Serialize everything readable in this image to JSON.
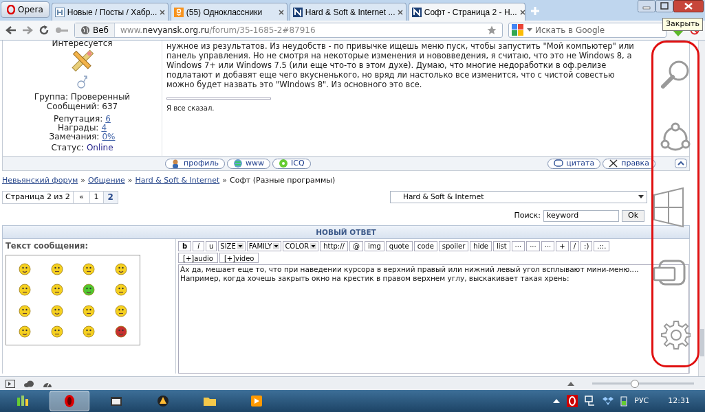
{
  "browser": {
    "menu_label": "Opera",
    "tabs": [
      {
        "title": "Новые / Посты / Хабр...",
        "kind": "habr",
        "selected": false
      },
      {
        "title": "(55) Одноклассники",
        "kind": "ok",
        "selected": false
      },
      {
        "title": "Hard & Soft & Internet ...",
        "kind": "n",
        "selected": false
      },
      {
        "title": "Софт - Страница 2 - Н...",
        "kind": "n",
        "selected": true
      }
    ],
    "badge": "Веб",
    "url_prefix": "www.",
    "url_host": "nevyansk.org.ru",
    "url_path": "/forum/35-1685-2#87916",
    "search_placeholder": "Искать в Google",
    "tooltip": "Закрыть"
  },
  "post": {
    "author": {
      "interest": "Интересуется",
      "group": "Группа: Проверенный",
      "messages": "Сообщений: 637",
      "stats": [
        {
          "label": "Репутация:",
          "value": "6",
          "kind": "link"
        },
        {
          "label": "Награды:",
          "value": "4",
          "kind": "link"
        },
        {
          "label": "Замечания:",
          "value": "0%",
          "kind": "link"
        },
        {
          "label": "Статус:",
          "value": "Online",
          "kind": "status"
        }
      ]
    },
    "text": "нужное из результатов. Из неудобств - по привычке ищешь меню пуск, чтобы запустить \"Мой компьютер\" или панель управления. Но не смотря на некоторые изменения и нововведения, я считаю, что это не Windows 8, а Windows 7+ или Windows 7.5 (или еще что-то в этом духе). Думаю, что многие недоработки в оф.релизе подлатают и добавят еще чего вкусненького, но вряд ли настолько все изменится, что с чистой совестью можно будет назвать это \"WIndows 8\". Из основного это все.",
    "signature": "Я все сказал.",
    "buttons_left": [
      "профиль",
      "www",
      "ICQ"
    ],
    "buttons_right": [
      "цитата",
      "правка"
    ]
  },
  "breadcrumb": [
    {
      "text": "Невьянский форум",
      "kind": "link"
    },
    {
      "text": "»",
      "kind": "sep"
    },
    {
      "text": "Общение",
      "kind": "link"
    },
    {
      "text": "»",
      "kind": "sep"
    },
    {
      "text": "Hard & Soft & Internet",
      "kind": "link"
    },
    {
      "text": "»",
      "kind": "sep"
    },
    {
      "text": "Софт (Разные программы)",
      "kind": "current"
    }
  ],
  "pagination": {
    "label": "Страница 2 из 2",
    "first": "«",
    "pages": [
      {
        "label": "1",
        "selected": false
      },
      {
        "label": "2",
        "selected": true
      }
    ]
  },
  "forum_jump": "Hard & Soft & Internet",
  "search": {
    "label": "Поиск:",
    "value": "keyword",
    "button": "Ok"
  },
  "reply": {
    "header": "НОВЫЙ ОТВЕТ",
    "label": "Текст сообщения:",
    "toolbar": [
      {
        "text": "b",
        "kind": "bold"
      },
      {
        "text": "i",
        "kind": "italic"
      },
      {
        "text": "u",
        "kind": "plain"
      },
      {
        "text": "SIZE",
        "kind": "select"
      },
      {
        "text": "FAMILY",
        "kind": "select"
      },
      {
        "text": "COLOR",
        "kind": "select"
      },
      {
        "text": "http://",
        "kind": "plain"
      },
      {
        "text": "@",
        "kind": "plain"
      },
      {
        "text": "img",
        "kind": "plain"
      },
      {
        "text": "quote",
        "kind": "plain"
      },
      {
        "text": "code",
        "kind": "plain"
      },
      {
        "text": "spoiler",
        "kind": "plain"
      },
      {
        "text": "hide",
        "kind": "plain"
      },
      {
        "text": "list",
        "kind": "plain"
      },
      {
        "text": "···",
        "kind": "plain"
      },
      {
        "text": "···",
        "kind": "plain"
      },
      {
        "text": "···",
        "kind": "plain"
      },
      {
        "text": "+",
        "kind": "plain"
      },
      {
        "text": "/",
        "kind": "plain"
      },
      {
        "text": ":)",
        "kind": "plain"
      },
      {
        "text": ".::.",
        "kind": "plain"
      }
    ],
    "toolbar2": [
      "[+]audio",
      "[+]video"
    ],
    "message": "Ах да, мешает еще то, что при наведении курсора в верхний правый или нижний левый угол всплывают мини-меню....\nНапример, когда хочешь закрыть окно на крестик в правом верхнем углу, выскакивает такая хрень:"
  },
  "status_bar": {
    "zoom": {
      "level": 0.42
    }
  },
  "taskbar": {
    "language": "РУС",
    "time": "12:31"
  }
}
